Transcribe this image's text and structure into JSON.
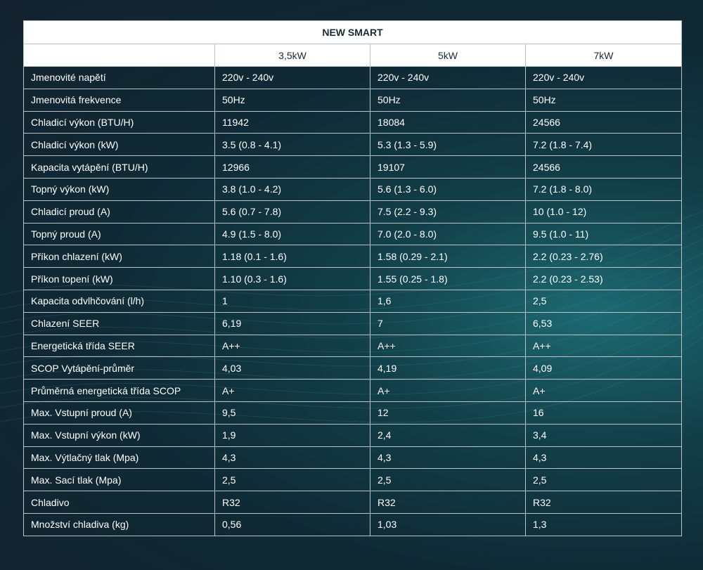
{
  "table": {
    "title": "NEW SMART",
    "columns": [
      "",
      "3,5kW",
      "5kW",
      "7kW"
    ],
    "rows": [
      {
        "label": "Jmenovité napětí",
        "values": [
          "220v - 240v",
          "220v - 240v",
          "220v - 240v"
        ]
      },
      {
        "label": "Jmenovitá frekvence",
        "values": [
          "50Hz",
          "50Hz",
          "50Hz"
        ]
      },
      {
        "label": "Chladicí výkon (BTU/H)",
        "values": [
          "11942",
          "18084",
          "24566"
        ]
      },
      {
        "label": "Chladicí výkon (kW)",
        "values": [
          "3.5 (0.8 - 4.1)",
          "5.3 (1.3 - 5.9)",
          "7.2 (1.8 - 7.4)"
        ]
      },
      {
        "label": "Kapacita vytápění (BTU/H)",
        "values": [
          "12966",
          "19107",
          "24566"
        ]
      },
      {
        "label": "Topný výkon (kW)",
        "values": [
          "3.8 (1.0 - 4.2)",
          "5.6 (1.3 - 6.0)",
          "7.2 (1.8 - 8.0)"
        ]
      },
      {
        "label": "Chladicí proud (A)",
        "values": [
          "5.6 (0.7 - 7.8)",
          "7.5 (2.2 - 9.3)",
          "10 (1.0 - 12)"
        ]
      },
      {
        "label": "Topný proud (A)",
        "values": [
          "4.9 (1.5 - 8.0)",
          "7.0 (2.0 - 8.0)",
          "9.5 (1.0 - 11)"
        ]
      },
      {
        "label": "Příkon chlazení (kW)",
        "values": [
          "1.18 (0.1 - 1.6)",
          "1.58 (0.29 - 2.1)",
          "2.2 (0.23 - 2.76)"
        ]
      },
      {
        "label": "Příkon topení (kW)",
        "values": [
          "1.10 (0.3 - 1.6)",
          "1.55 (0.25 - 1.8)",
          "2.2 (0.23 - 2.53)"
        ]
      },
      {
        "label": "Kapacita odvlhčování (l/h)",
        "values": [
          "1",
          "1,6",
          "2,5"
        ]
      },
      {
        "label": "Chlazení SEER",
        "values": [
          "6,19",
          "7",
          "6,53"
        ]
      },
      {
        "label": "Energetická třída SEER",
        "values": [
          "A++",
          "A++",
          "A++"
        ]
      },
      {
        "label": "SCOP Vytápění-průměr",
        "values": [
          "4,03",
          "4,19",
          "4,09"
        ]
      },
      {
        "label": "Průměrná energetická třída SCOP",
        "values": [
          "A+",
          "A+",
          "A+"
        ]
      },
      {
        "label": "Max. Vstupní proud (A)",
        "values": [
          "9,5",
          "12",
          "16"
        ]
      },
      {
        "label": "Max. Vstupní výkon (kW)",
        "values": [
          "1,9",
          "2,4",
          "3,4"
        ]
      },
      {
        "label": "Max. Výtlačný tlak (Mpa)",
        "values": [
          "4,3",
          "4,3",
          "4,3"
        ]
      },
      {
        "label": "Max. Sací tlak (Mpa)",
        "values": [
          "2,5",
          "2,5",
          "2,5"
        ]
      },
      {
        "label": "Chladivo",
        "values": [
          "R32",
          "R32",
          "R32"
        ]
      },
      {
        "label": "Množství chladiva (kg)",
        "values": [
          "0,56",
          "1,03",
          "1,3"
        ]
      }
    ]
  },
  "colors": {
    "background": "#0f2a35",
    "accent": "#1d6a72",
    "header_bg": "#ffffff",
    "header_text": "#1a2a33",
    "border": "#b9c3c8",
    "cell_text": "#ffffff"
  }
}
